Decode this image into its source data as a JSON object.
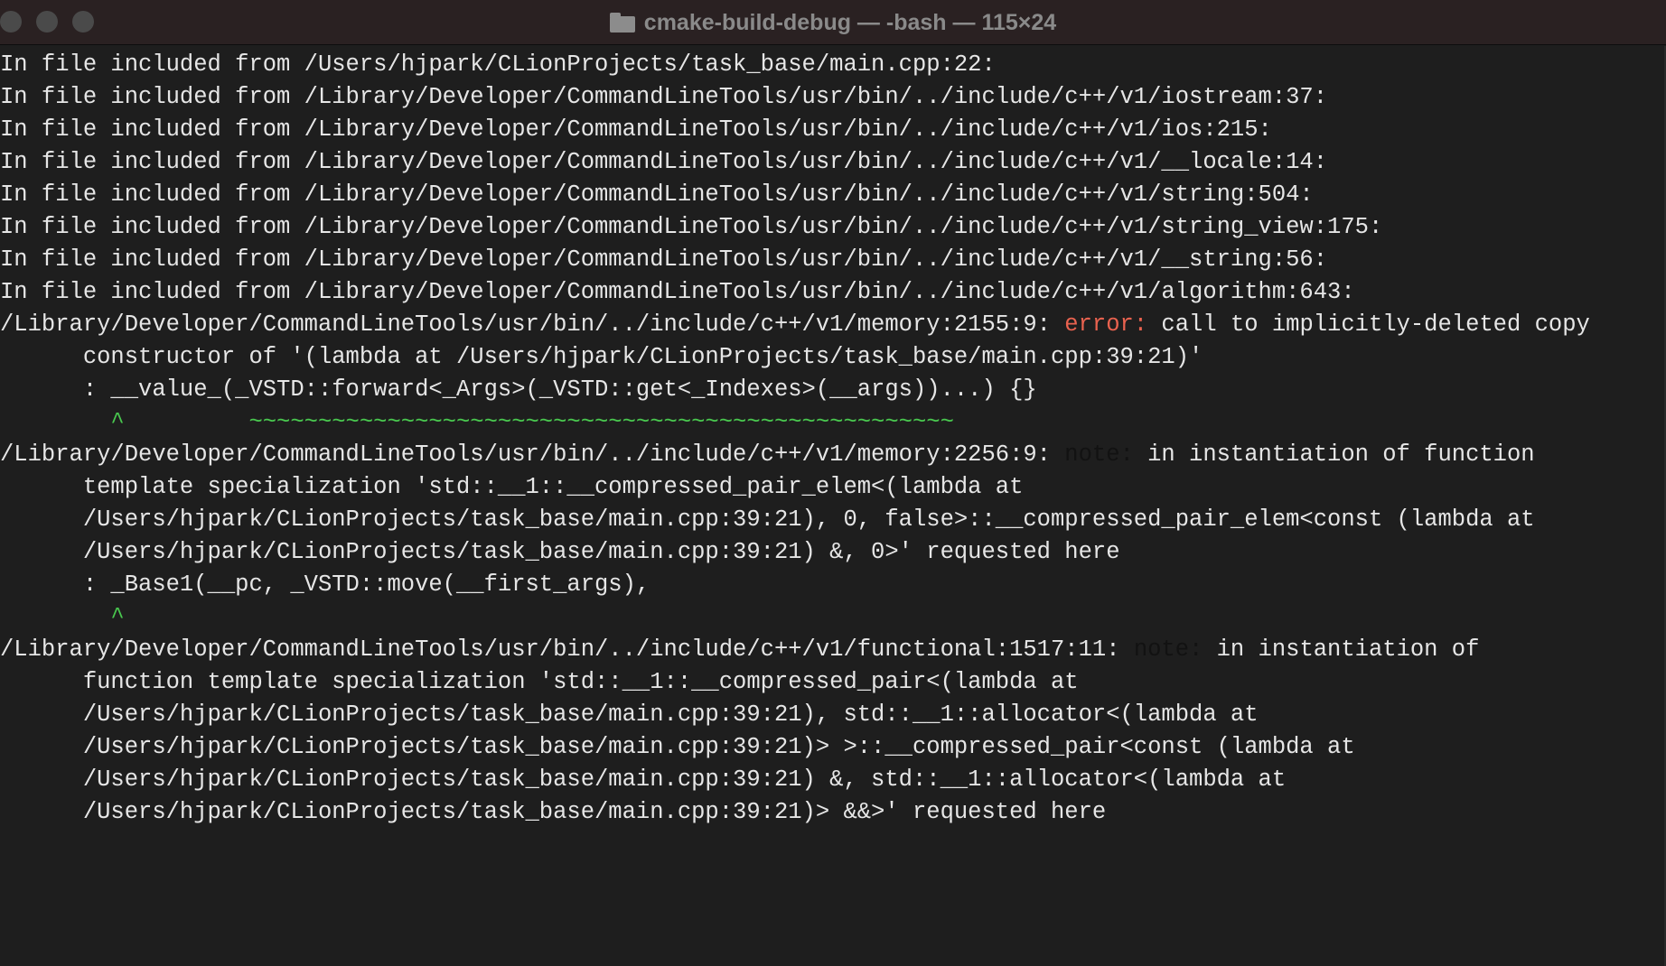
{
  "window": {
    "title": "cmake-build-debug — -bash — 115×24",
    "folder_icon": "folder-icon"
  },
  "terminal": {
    "lines": [
      [
        "In file included from /Users/hjpark/CLionProjects/task_base/main.cpp:22:"
      ],
      [
        "In file included from /Library/Developer/CommandLineTools/usr/bin/../include/c++/v1/iostream:37:"
      ],
      [
        "In file included from /Library/Developer/CommandLineTools/usr/bin/../include/c++/v1/ios:215:"
      ],
      [
        "In file included from /Library/Developer/CommandLineTools/usr/bin/../include/c++/v1/__locale:14:"
      ],
      [
        "In file included from /Library/Developer/CommandLineTools/usr/bin/../include/c++/v1/string:504:"
      ],
      [
        "In file included from /Library/Developer/CommandLineTools/usr/bin/../include/c++/v1/string_view:175:"
      ],
      [
        "In file included from /Library/Developer/CommandLineTools/usr/bin/../include/c++/v1/__string:56:"
      ],
      [
        "In file included from /Library/Developer/CommandLineTools/usr/bin/../include/c++/v1/algorithm:643:"
      ],
      [
        "/Library/Developer/CommandLineTools/usr/bin/../include/c++/v1/memory:2155:9: ",
        "error:",
        " call to implicitly-deleted copy"
      ],
      [
        "      constructor of '(lambda at /Users/hjpark/CLionProjects/task_base/main.cpp:39:21)'"
      ],
      [
        "      : __value_(_VSTD::forward<_Args>(_VSTD::get<_Indexes>(__args))...) {}"
      ],
      [
        "        ^         ~~~~~~~~~~~~~~~~~~~~~~~~~~~~~~~~~~~~~~~~~~~~~~~~~~~"
      ],
      [
        "/Library/Developer/CommandLineTools/usr/bin/../include/c++/v1/memory:2256:9: ",
        "note:",
        " in instantiation of function"
      ],
      [
        "      template specialization 'std::__1::__compressed_pair_elem<(lambda at"
      ],
      [
        "      /Users/hjpark/CLionProjects/task_base/main.cpp:39:21), 0, false>::__compressed_pair_elem<const (lambda at"
      ],
      [
        "      /Users/hjpark/CLionProjects/task_base/main.cpp:39:21) &, 0>' requested here"
      ],
      [
        "      : _Base1(__pc, _VSTD::move(__first_args),"
      ],
      [
        "        ^"
      ],
      [
        "/Library/Developer/CommandLineTools/usr/bin/../include/c++/v1/functional:1517:11: ",
        "note:",
        " in instantiation of"
      ],
      [
        "      function template specialization 'std::__1::__compressed_pair<(lambda at"
      ],
      [
        "      /Users/hjpark/CLionProjects/task_base/main.cpp:39:21), std::__1::allocator<(lambda at"
      ],
      [
        "      /Users/hjpark/CLionProjects/task_base/main.cpp:39:21)> >::__compressed_pair<const (lambda at"
      ],
      [
        "      /Users/hjpark/CLionProjects/task_base/main.cpp:39:21) &, std::__1::allocator<(lambda at"
      ],
      [
        "      /Users/hjpark/CLionProjects/task_base/main.cpp:39:21)> &&>' requested here"
      ]
    ]
  },
  "colors": {
    "background": "#1e1e1e",
    "text": "#e6e6e6",
    "error": "#e9624f",
    "note": "#121212",
    "caret": "#49c84f",
    "titlebar": "#2a2122"
  }
}
